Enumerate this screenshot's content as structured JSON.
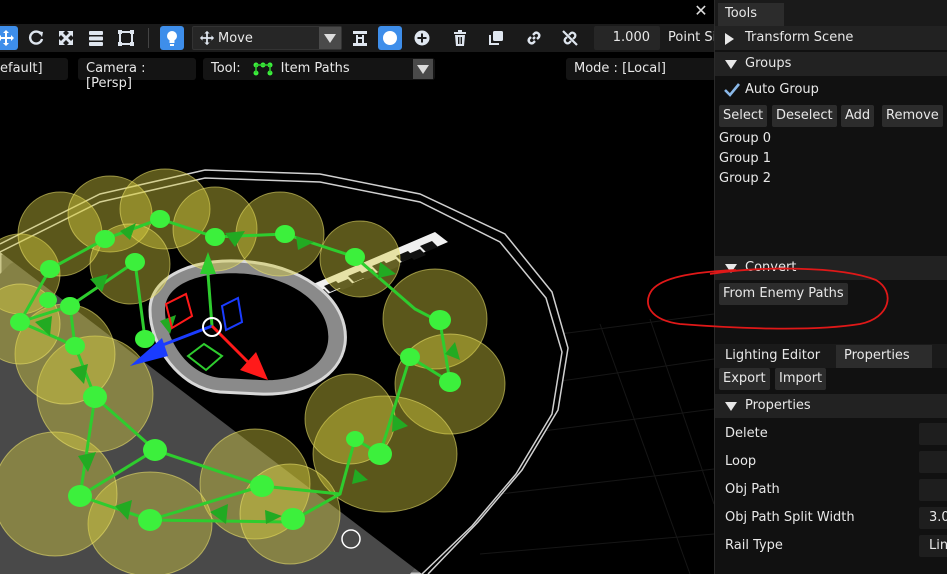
{
  "toolbar": {
    "move_label": "Move",
    "scale_value": "1.000",
    "point_size_label": "Point Si"
  },
  "infobar": {
    "layer_label": "efault]",
    "camera_label": "Camera : [Persp]",
    "tool_prefix": "Tool:",
    "tool_value": "Item Paths",
    "mode_label": "Mode : [Local]"
  },
  "panel": {
    "tools_tab": "Tools",
    "transform_scene": "Transform Scene",
    "groups": {
      "header": "Groups",
      "auto_group": "Auto Group",
      "auto_group_checked": true,
      "select": "Select",
      "deselect": "Deselect",
      "add": "Add",
      "remove": "Remove",
      "items": [
        "Group 0",
        "Group 1",
        "Group 2"
      ]
    },
    "convert": {
      "header": "Convert",
      "from_enemy_paths": "From Enemy Paths"
    },
    "tabs": [
      "Lighting Editor",
      "Properties"
    ],
    "export": "Export",
    "import": "Import",
    "properties": {
      "header": "Properties",
      "rows": [
        {
          "name": "Delete",
          "value": ""
        },
        {
          "name": "Loop",
          "value": ""
        },
        {
          "name": "Obj Path",
          "value": ""
        },
        {
          "name": "Obj Path Split Width",
          "value": "3.0"
        },
        {
          "name": "Rail Type",
          "value": "Lin"
        }
      ]
    }
  },
  "colors": {
    "accent": "#3e8eea",
    "node_green": "#3cf03c",
    "path_green": "#2ecc2e",
    "sphere_yellow": "#d8d040",
    "annotation_red": "#e01818"
  }
}
